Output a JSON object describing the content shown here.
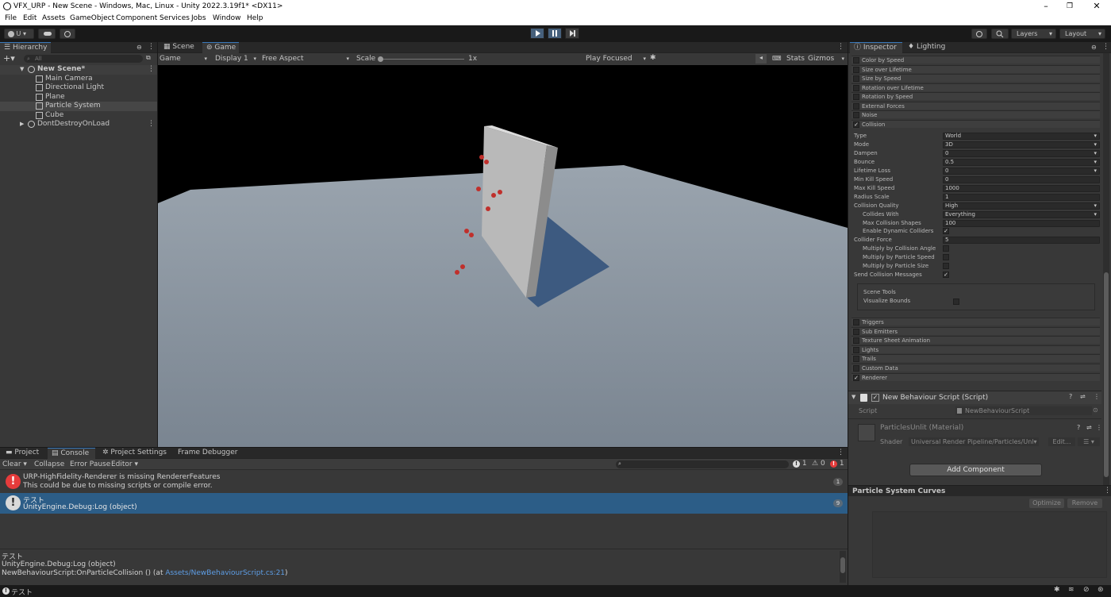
{
  "window": {
    "title": "VFX_URP - New Scene - Windows, Mac, Linux - Unity 2022.3.19f1* <DX11>"
  },
  "menu": [
    "File",
    "Edit",
    "Assets",
    "GameObject",
    "Component",
    "Services",
    "Jobs",
    "Window",
    "Help"
  ],
  "toolbar": {
    "account": "U ▾",
    "layers": "Layers",
    "layout": "Layout"
  },
  "hierarchy": {
    "tab": "Hierarchy",
    "search_placeholder": "All",
    "scene": "New Scene*",
    "items": [
      "Main Camera",
      "Directional Light",
      "Plane",
      "Particle System",
      "Cube"
    ],
    "dontdestroy": "DontDestroyOnLoad"
  },
  "view": {
    "tabs": [
      "Scene",
      "Game"
    ],
    "game_dropdown": "Game",
    "display": "Display 1",
    "aspect": "Free Aspect",
    "scale_label": "Scale",
    "scale_value": "1x",
    "play_focused": "Play Focused",
    "stats": "Stats",
    "gizmos": "Gizmos"
  },
  "inspector": {
    "tabs": [
      "Inspector",
      "Lighting"
    ],
    "modules_top": [
      {
        "label": "Color by Speed",
        "checked": false
      },
      {
        "label": "Size over Lifetime",
        "checked": false
      },
      {
        "label": "Size by Speed",
        "checked": false
      },
      {
        "label": "Rotation over Lifetime",
        "checked": false
      },
      {
        "label": "Rotation by Speed",
        "checked": false
      },
      {
        "label": "External Forces",
        "checked": false
      },
      {
        "label": "Noise",
        "checked": false
      },
      {
        "label": "Collision",
        "checked": true
      }
    ],
    "collision_props": [
      {
        "label": "Type",
        "value": "World",
        "kind": "dd",
        "indent": false
      },
      {
        "label": "Mode",
        "value": "3D",
        "kind": "dd",
        "indent": false
      },
      {
        "label": "Dampen",
        "value": "0",
        "kind": "dd",
        "indent": false
      },
      {
        "label": "Bounce",
        "value": "0.5",
        "kind": "dd",
        "indent": false
      },
      {
        "label": "Lifetime Loss",
        "value": "0",
        "kind": "dd",
        "indent": false
      },
      {
        "label": "Min Kill Speed",
        "value": "0",
        "kind": "field",
        "indent": false
      },
      {
        "label": "Max Kill Speed",
        "value": "1000",
        "kind": "field",
        "indent": false
      },
      {
        "label": "Radius Scale",
        "value": "1",
        "kind": "field",
        "indent": false
      },
      {
        "label": "Collision Quality",
        "value": "High",
        "kind": "dd",
        "indent": false
      },
      {
        "label": "Collides With",
        "value": "Everything",
        "kind": "dd",
        "indent": true
      },
      {
        "label": "Max Collision Shapes",
        "value": "100",
        "kind": "field",
        "indent": true
      },
      {
        "label": "Enable Dynamic Colliders",
        "value": "✓",
        "kind": "cb",
        "indent": true
      },
      {
        "label": "Collider Force",
        "value": "5",
        "kind": "field",
        "indent": false
      },
      {
        "label": "Multiply by Collision Angle",
        "value": "",
        "kind": "cb",
        "indent": true
      },
      {
        "label": "Multiply by Particle Speed",
        "value": "",
        "kind": "cb",
        "indent": true
      },
      {
        "label": "Multiply by Particle Size",
        "value": "",
        "kind": "cb",
        "indent": true
      },
      {
        "label": "Send Collision Messages",
        "value": "✓",
        "kind": "cb",
        "indent": false
      }
    ],
    "scene_tools": {
      "title": "Scene Tools",
      "visualize": "Visualize Bounds"
    },
    "modules_bottom": [
      {
        "label": "Triggers",
        "checked": false
      },
      {
        "label": "Sub Emitters",
        "checked": false
      },
      {
        "label": "Texture Sheet Animation",
        "checked": false
      },
      {
        "label": "Lights",
        "checked": false
      },
      {
        "label": "Trails",
        "checked": false
      },
      {
        "label": "Custom Data",
        "checked": false
      },
      {
        "label": "Renderer",
        "checked": true
      }
    ],
    "script_component": {
      "title": "New Behaviour Script (Script)",
      "script_label": "Script",
      "script_value": "NewBehaviourScript"
    },
    "material": {
      "title": "ParticlesUnlit (Material)",
      "shader_label": "Shader",
      "shader_value": "Universal Render Pipeline/Particles/Unl▾",
      "edit": "Edit..."
    },
    "add_component": "Add Component",
    "curves": {
      "title": "Particle System Curves",
      "optimize": "Optimize",
      "remove": "Remove"
    }
  },
  "console": {
    "tabs": [
      "Project",
      "Console",
      "Project Settings",
      "Frame Debugger"
    ],
    "toolbar": {
      "clear": "Clear",
      "collapse": "Collapse",
      "error_pause": "Error Pause",
      "editor": "Editor"
    },
    "counts": {
      "info": "1",
      "warn": "0",
      "error": "1"
    },
    "entries": [
      {
        "type": "error",
        "line1": "URP-HighFidelity-Renderer is missing RendererFeatures",
        "line2": "This could be due to missing scripts or compile error.",
        "count": "1"
      },
      {
        "type": "info",
        "line1": "テスト",
        "line2": "UnityEngine.Debug:Log (object)",
        "count": "9"
      }
    ],
    "detail": {
      "line1": "テスト",
      "line2": "UnityEngine.Debug:Log (object)",
      "line3_prefix": "NewBehaviourScript:OnParticleCollision () (at ",
      "line3_link": "Assets/NewBehaviourScript.cs:21",
      "line3_suffix": ")"
    }
  },
  "status": {
    "text": "テスト"
  },
  "colors": {
    "accent": "#3a79bb",
    "selected_row": "#2c5d87",
    "error": "#e63b3b",
    "particle": "#c0302c"
  }
}
